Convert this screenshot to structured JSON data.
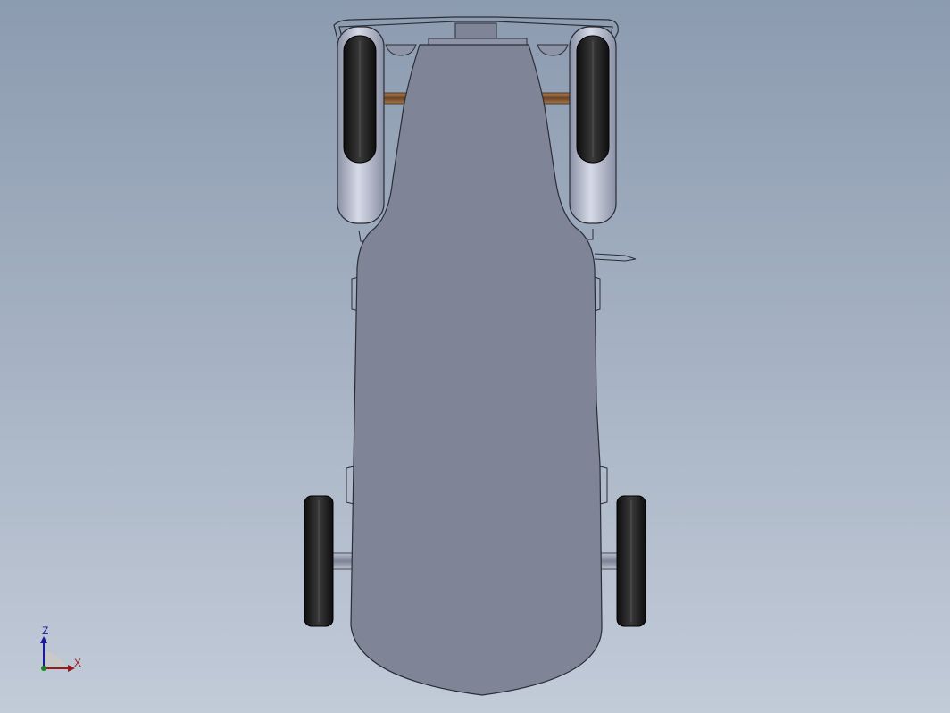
{
  "viewport": {
    "background_top": "#8c9bb0",
    "background_bottom": "#c2cbd8"
  },
  "model": {
    "body_color": "#7f8596",
    "outline_color": "#2a2d36",
    "tire_color": "#1f1f1f",
    "axle_color": "#7a5432",
    "fender_color": "#a2a8bd"
  },
  "triad": {
    "z_label": "Z",
    "x_label": "X",
    "z_color": "#1a1a9a",
    "x_color": "#9a1a1a",
    "y_color": "#1a8a1a"
  }
}
